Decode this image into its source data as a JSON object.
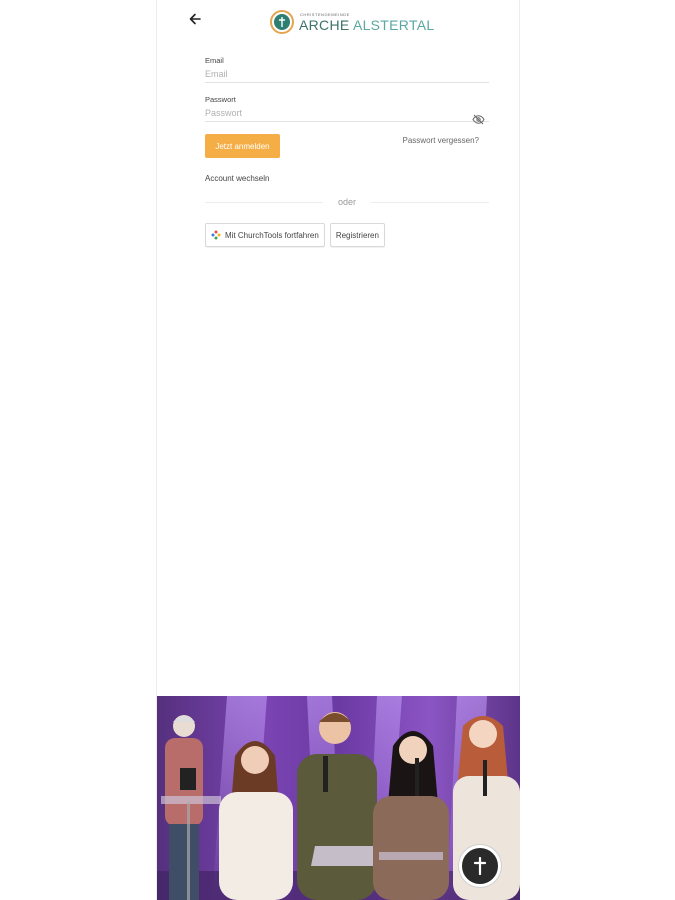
{
  "header": {
    "logo_small": "Christengemeinde",
    "logo_word1": "ARCHE",
    "logo_word2": "ALSTERTAL"
  },
  "form": {
    "email_label": "Email",
    "email_placeholder": "Email",
    "password_label": "Passwort",
    "password_placeholder": "Passwort",
    "login_button": "Jetzt anmelden",
    "forgot_password": "Passwort vergessen?",
    "switch_account": "Account wechseln",
    "divider_text": "oder",
    "churchtools_button": "Mit ChurchTools fortfahren",
    "register_button": "Registrieren"
  },
  "icons": {
    "back": "arrow-left-icon",
    "password_toggle": "eye-off-icon",
    "churchtools": "churchtools-icon",
    "fab": "cross-icon"
  },
  "colors": {
    "primary_button": "#f5ae45",
    "logo_dark": "#3d7269",
    "logo_light": "#59a7a1",
    "photo_bg": "#7a44b2"
  }
}
